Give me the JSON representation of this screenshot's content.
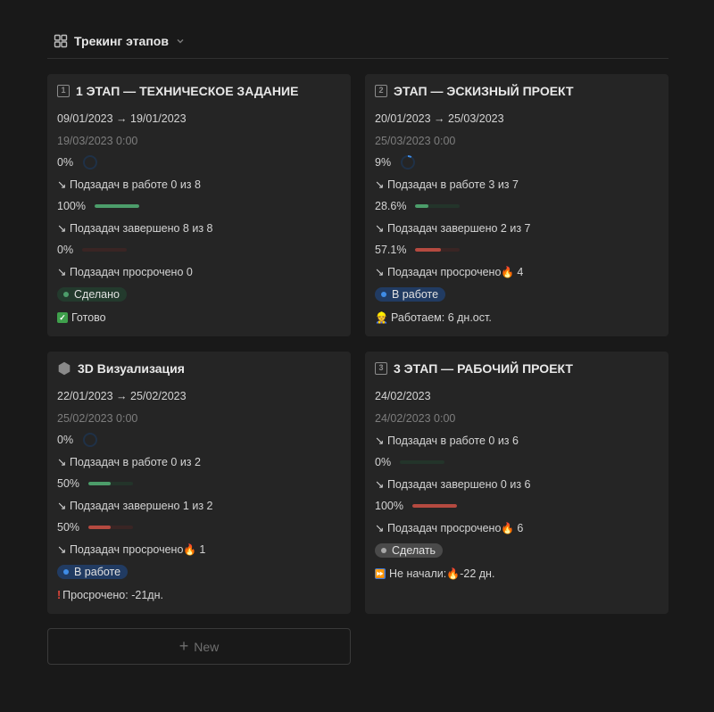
{
  "header": {
    "title": "Трекинг этапов",
    "icon": "gallery-view-icon"
  },
  "cards": [
    {
      "icon_label": "1",
      "title": "1 ЭТАП — ТЕХНИЧЕСКОЕ ЗАДАНИЕ",
      "dates": "09/01/2023 → 19/01/2023",
      "deadline": "19/03/2023 0:00",
      "in_work_pct": "0%",
      "in_work_ratio": 0,
      "in_work_text": "↘ Подзадач в работе 0 из 8",
      "done_pct": "100%",
      "done_ratio": 1.0,
      "done_text": "↘ Подзадач завершено 8 из 8",
      "overdue_pct": "0%",
      "overdue_ratio": 0,
      "overdue_text": "↘ Подзадач просрочено 0",
      "status": "Сделано",
      "note_emoji": "✓",
      "note": "Готово"
    },
    {
      "icon_label": "2",
      "title": "ЭТАП — ЭСКИЗНЫЙ ПРОЕКТ",
      "dates": "20/01/2023 → 25/03/2023",
      "deadline": "25/03/2023 0:00",
      "in_work_pct": "9%",
      "in_work_ratio": 0.09,
      "in_work_text": "↘ Подзадач в работе 3 из 7",
      "done_pct": "28.6%",
      "done_ratio": 0.286,
      "done_text": "↘ Подзадач завершено 2 из 7",
      "overdue_pct": "57.1%",
      "overdue_ratio": 0.571,
      "overdue_text_prefix": "↘ Подзадач просрочено ",
      "overdue_emoji": "🔥",
      "overdue_count": "4",
      "status": "В работе",
      "note_emoji": "👷",
      "note": "Работаем: 6 дн.ост."
    },
    {
      "icon_label": "hexagon-icon",
      "title": "3D Визуализация",
      "dates": "22/01/2023 → 25/02/2023",
      "deadline": "25/02/2023 0:00",
      "in_work_pct": "0%",
      "in_work_ratio": 0,
      "in_work_text": "↘ Подзадач в работе 0 из 2",
      "done_pct": "50%",
      "done_ratio": 0.5,
      "done_text": "↘ Подзадач завершено 1 из 2",
      "overdue_pct": "50%",
      "overdue_ratio": 0.5,
      "overdue_text_prefix": "↘ Подзадач просрочено ",
      "overdue_emoji": "🔥",
      "overdue_count": "1",
      "status": "В работе",
      "note_emoji": "!",
      "note": "Просрочено: -21дн."
    },
    {
      "icon_label": "3",
      "title": "3 ЭТАП — РАБОЧИЙ ПРОЕКТ",
      "dates": "24/02/2023",
      "deadline": "24/02/2023 0:00",
      "in_work_text": "↘ Подзадач в работе 0 из 6",
      "done_pct": "0%",
      "done_ratio": 0,
      "done_text": "↘ Подзадач завершено 0 из 6",
      "overdue_pct": "100%",
      "overdue_ratio": 1.0,
      "overdue_text_prefix": "↘ Подзадач просрочено ",
      "overdue_emoji": "🔥",
      "overdue_count": "6",
      "status": "Сделать",
      "note_emoji": "⏩",
      "note_prefix": "Не начали: ",
      "note_fire": "🔥",
      "note_suffix": "-22 дн."
    }
  ],
  "new_button": {
    "label": "New"
  },
  "colors": {
    "background": "#191919",
    "card": "#252525",
    "green": "#4c9d6a",
    "red": "#b54a40",
    "blue": "#3f8ce6"
  }
}
